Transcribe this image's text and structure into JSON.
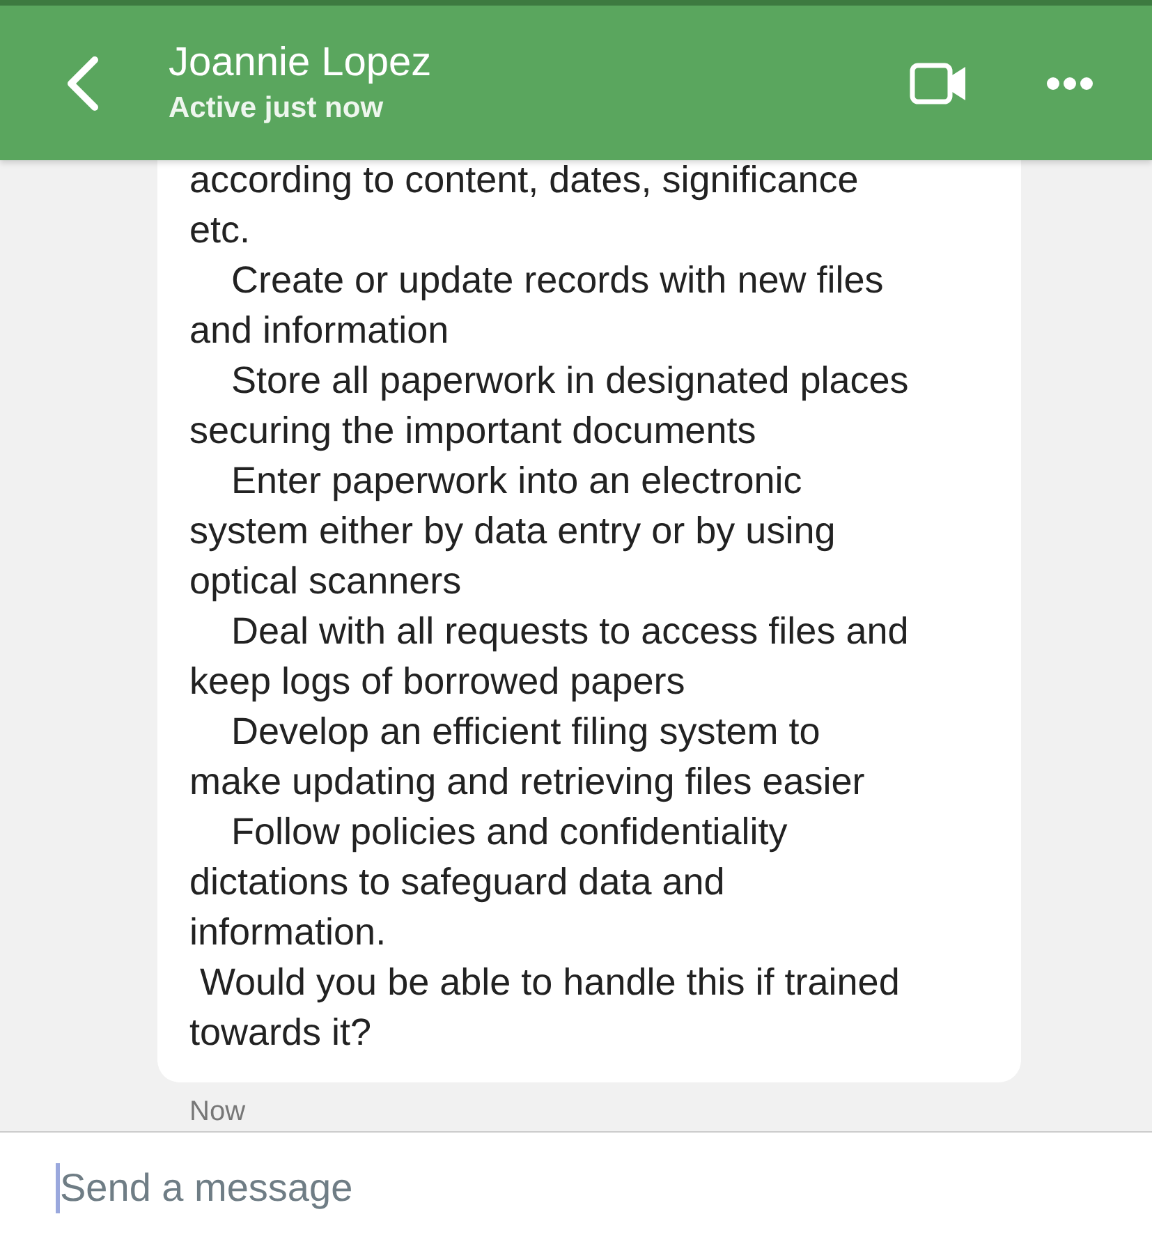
{
  "header": {
    "title": "Joannie Lopez",
    "status": "Active just now",
    "actions": [
      {
        "kind": "video"
      },
      {
        "kind": "more"
      }
    ]
  },
  "message": {
    "text": "according to content, dates, significance\netc.\n    Create or update records with new files\nand information\n    Store all paperwork in designated places\nsecuring the important documents\n    Enter paperwork into an electronic\nsystem either by data entry or by using\noptical scanners\n    Deal with all requests to access files and\nkeep logs of borrowed papers\n    Develop an efficient filing system to\nmake updating and retrieving files easier\n    Follow policies and confidentiality\ndictations to safeguard data and\ninformation.\n Would you be able to handle this if trained\ntowards it?",
    "time": "Now"
  },
  "composer": {
    "placeholder": "Send a message"
  }
}
